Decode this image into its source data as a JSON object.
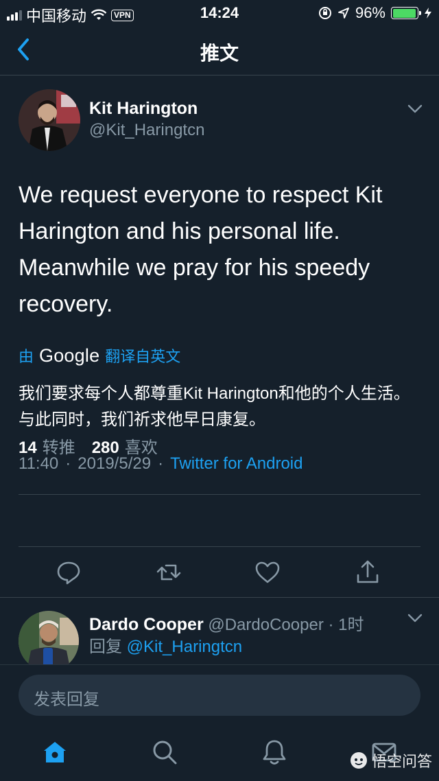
{
  "status_bar": {
    "carrier": "中国移动",
    "vpn": "VPN",
    "time": "14:24",
    "battery": "96%",
    "battery_level": 0.96,
    "battery_color": "#4cd964"
  },
  "nav": {
    "title": "推文",
    "back_icon": "chevron-left-icon"
  },
  "tweet": {
    "author_name": "Kit Harington",
    "author_handle": "@Kit_Haringtcn",
    "text": "We request everyone to respect Kit Harington and his personal life. Meanwhile we pray for his speedy recovery.",
    "translate_prefix": "由",
    "translate_brand": "Google",
    "translate_suffix": "翻译自英文",
    "translated_text": "我们要求每个人都尊重Kit Harington和他的个人生活。与此同时，我们祈求他早日康复。",
    "time": "11:40",
    "dot": "·",
    "date": "2019/5/29",
    "source": "Twitter for Android",
    "retweet_count": "14",
    "retweet_label": "转推",
    "like_count": "280",
    "like_label": "喜欢"
  },
  "actions": [
    "reply-icon",
    "retweet-icon",
    "heart-icon",
    "share-icon"
  ],
  "reply": {
    "author_name": "Dardo Cooper",
    "author_handle": "@DardoCooper",
    "dot": "·",
    "age": "1时",
    "reply_prefix": "回复",
    "reply_to": "@Kit_Haringtcn"
  },
  "composer": {
    "placeholder": "发表回复"
  },
  "tab_bar": [
    "home-icon",
    "search-icon",
    "bell-icon",
    "mail-icon"
  ],
  "watermark": "悟空问答",
  "colors": {
    "background": "#15202b",
    "accent": "#1da1f2",
    "secondary_text": "#8899a6",
    "divider": "#38444d"
  }
}
